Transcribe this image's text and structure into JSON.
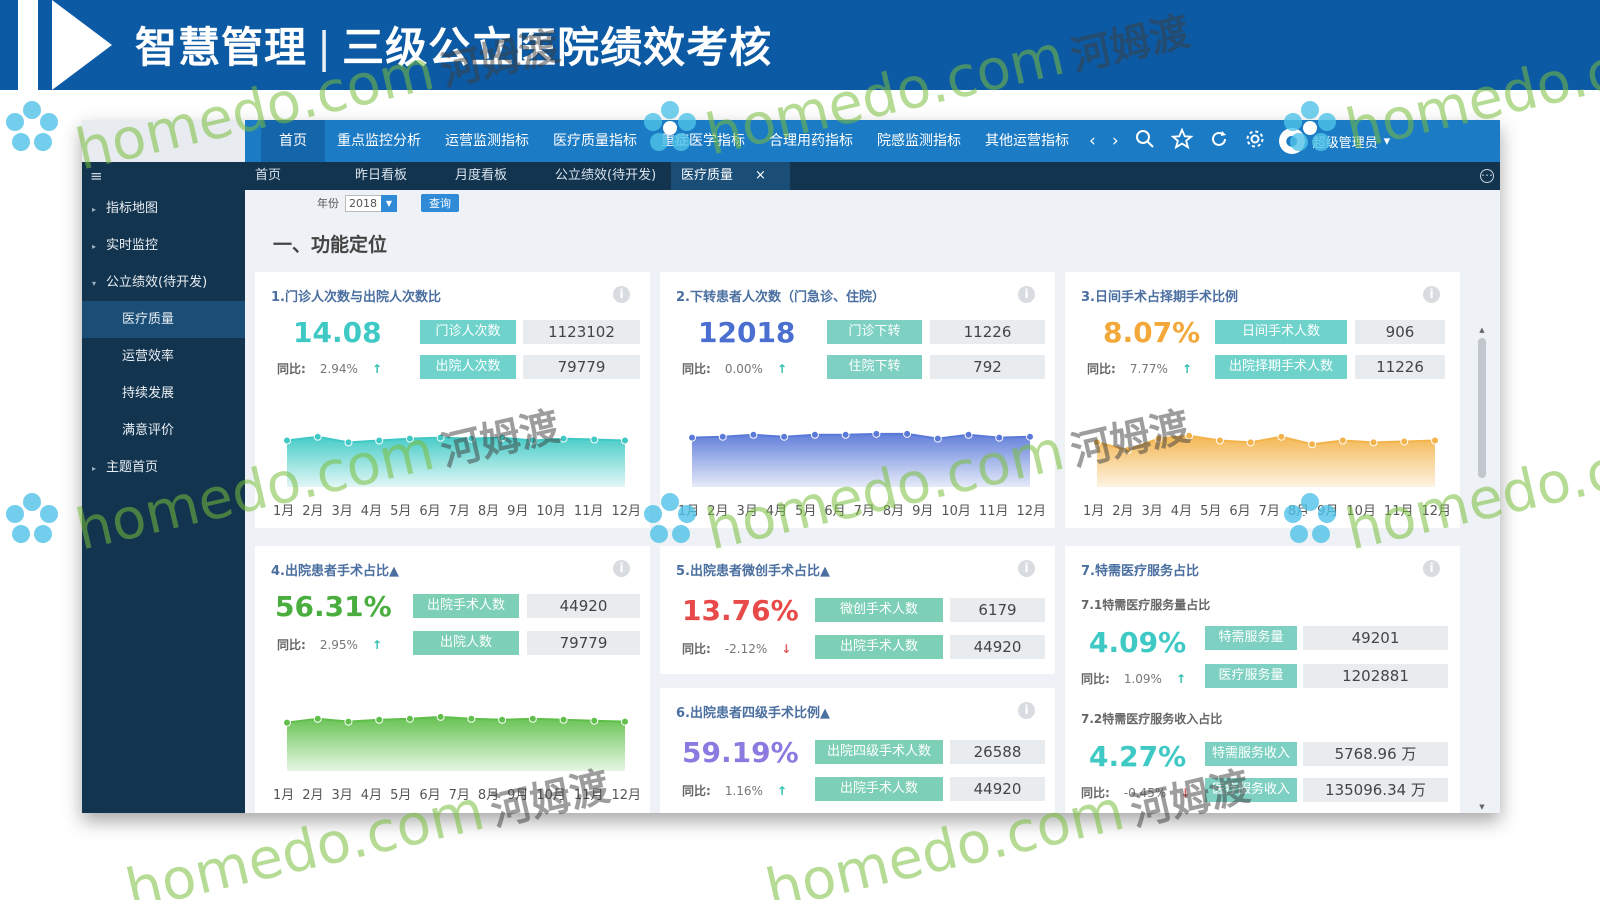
{
  "banner": {
    "title_left": "智慧管理",
    "separator": "|",
    "title_right": "三级公立医院绩效考核"
  },
  "topnav": {
    "items": [
      "首页",
      "重点监控分析",
      "运营监测指标",
      "医疗质量指标",
      "重症医学指标",
      "合理用药指标",
      "院感监测指标",
      "其他运营指标"
    ],
    "prev": "‹",
    "next": "›",
    "icons": [
      "search-icon",
      "star-icon",
      "refresh-icon",
      "settings-icon"
    ],
    "user": "超级管理员",
    "user_caret": "▾"
  },
  "sidebar": {
    "toggle": "≡",
    "items": [
      {
        "label": "指标地图",
        "arrow": "▸"
      },
      {
        "label": "实时监控",
        "arrow": "▸"
      },
      {
        "label": "公立绩效(待开发)",
        "arrow": "▾"
      }
    ],
    "subitems": [
      "医疗质量",
      "运营效率",
      "持续发展",
      "满意评价"
    ],
    "last_item": {
      "label": "主题首页",
      "arrow": "▸"
    }
  },
  "tabs": [
    "首页",
    "昨日看板",
    "月度看板",
    "公立绩效(待开发)",
    "医疗质量"
  ],
  "tab_close": "×",
  "filter": {
    "year_label": "年份",
    "year_value": "2018",
    "query_label": "查询"
  },
  "section_title": "一、功能定位",
  "months": [
    "1月",
    "2月",
    "3月",
    "4月",
    "5月",
    "6月",
    "7月",
    "8月",
    "9月",
    "10月",
    "11月",
    "12月"
  ],
  "yoy_label": "同比:",
  "cards": [
    {
      "title": "1.门诊人次数与出院人次数比",
      "value": "14.08",
      "yoy": "2.94%",
      "trend": "↑",
      "rows": [
        {
          "label": "门诊人次数",
          "value": "1123102"
        },
        {
          "label": "出院人次数",
          "value": "79779"
        }
      ],
      "color": "#3ec9c4",
      "chart_values": [
        70,
        74,
        68,
        70,
        72,
        73,
        72,
        73,
        70,
        72,
        71,
        70
      ]
    },
    {
      "title": "2.下转患者人次数（门急诊、住院）",
      "value": "12018",
      "yoy": "0.00%",
      "trend": "↑",
      "rows": [
        {
          "label": "门诊下转",
          "value": "11226"
        },
        {
          "label": "住院下转",
          "value": "792"
        }
      ],
      "color": "#5a79d8",
      "chart_values": [
        73,
        74,
        76,
        74,
        76,
        76,
        77,
        77,
        72,
        76,
        73,
        74
      ]
    },
    {
      "title": "3.日间手术占择期手术比例",
      "value": "8.07%",
      "yoy": "7.77%",
      "trend": "↑",
      "rows": [
        {
          "label": "日间手术人数",
          "value": "906"
        },
        {
          "label": "出院择期手术人数",
          "value": "11226"
        }
      ],
      "color": "#f3b34a",
      "chart_values": [
        68,
        60,
        72,
        75,
        70,
        68,
        74,
        66,
        70,
        68,
        69,
        70
      ]
    },
    {
      "title": "4.出院患者手术占比▲",
      "value": "56.31%",
      "yoy": "2.95%",
      "trend": "↑",
      "rows": [
        {
          "label": "出院手术人数",
          "value": "44920"
        },
        {
          "label": "出院人数",
          "value": "79779"
        }
      ],
      "color": "#5fbf4a",
      "chart_values": [
        72,
        76,
        73,
        75,
        76,
        78,
        76,
        75,
        76,
        75,
        74,
        73
      ]
    },
    {
      "title": "5.出院患者微创手术占比▲",
      "value": "13.76%",
      "yoy": "-2.12%",
      "trend": "↓",
      "rows": [
        {
          "label": "微创手术人数",
          "value": "6179"
        },
        {
          "label": "出院手术人数",
          "value": "44920"
        }
      ]
    },
    {
      "title": "6.出院患者四级手术比例▲",
      "value": "59.19%",
      "yoy": "1.16%",
      "trend": "↑",
      "rows": [
        {
          "label": "出院四级手术人数",
          "value": "26588"
        },
        {
          "label": "出院手术人数",
          "value": "44920"
        }
      ]
    },
    {
      "title": "7.特需医疗服务占比",
      "sub1": {
        "title": "7.1特需医疗服务量占比",
        "value": "4.09%",
        "yoy": "1.09%",
        "trend": "↑",
        "rows": [
          {
            "label": "特需服务量",
            "value": "49201"
          },
          {
            "label": "医疗服务量",
            "value": "1202881"
          }
        ]
      },
      "sub2": {
        "title": "7.2特需医疗服务收入占比",
        "value": "4.27%",
        "yoy": "-0.45%",
        "trend": "↓",
        "rows": [
          {
            "label": "特需服务收入",
            "value": "5768.96 万"
          },
          {
            "label": "医疗服务收入",
            "value": "135096.34 万"
          }
        ]
      }
    }
  ],
  "colors": {
    "teal": "#3ec9c4",
    "teal_label": "#6fd3cc",
    "blue_value": "#4a6fd0",
    "blue_label": "#7ed1c2",
    "orange": "#f3a83a",
    "orange_label": "#6fd3cc",
    "green": "#4aae3e",
    "green_label": "#7dd0b6",
    "red": "#e84a4a",
    "purple": "#8c7ae0"
  },
  "watermark": {
    "brand": "homedo.com",
    "cn": "河姆渡"
  }
}
